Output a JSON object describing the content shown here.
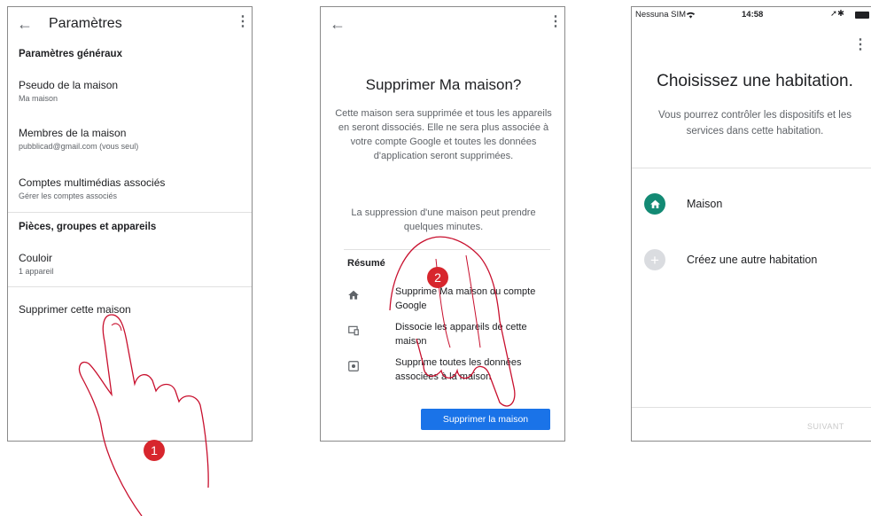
{
  "screen1": {
    "title": "Paramètres",
    "section_general": "Paramètres généraux",
    "items": [
      {
        "title": "Pseudo de la maison",
        "subtitle": "Ma maison"
      },
      {
        "title": "Membres de la maison",
        "subtitle": "pubblicad@gmail.com (vous seul)"
      },
      {
        "title": "Comptes multimédias associés",
        "subtitle": "Gérer les comptes associés"
      }
    ],
    "section_rooms": "Pièces, groupes et appareils",
    "room": {
      "title": "Couloir",
      "subtitle": "1 appareil"
    },
    "delete_label": "Supprimer cette maison"
  },
  "screen2": {
    "title": "Supprimer Ma maison?",
    "body": "Cette maison sera supprimée et tous les appareils en seront dissociés. Elle ne sera plus associée à votre compte Google et toutes les données d'application seront supprimées.",
    "note": "La suppression d'une maison peut prendre quelques minutes.",
    "summary_head": "Résumé",
    "summary": [
      {
        "icon": "home-icon",
        "text": "Supprime Ma maison du compte Google"
      },
      {
        "icon": "device-icon",
        "text": "Dissocie les appareils de cette maison"
      },
      {
        "icon": "data-icon",
        "text": "Supprime toutes les données associées à la maison"
      }
    ],
    "delete_button": "Supprimer la maison"
  },
  "screen3": {
    "status_carrier": "Nessuna SIM",
    "status_time": "14:58",
    "title": "Choisissez une habitation.",
    "body": "Vous pourrez contrôler les dispositifs et les services dans cette habitation.",
    "options": [
      {
        "label": "Maison",
        "icon": "home-icon"
      },
      {
        "label": "Créez une autre habitation",
        "icon": "plus-icon"
      }
    ],
    "next_button": "SUIVANT"
  },
  "steps": {
    "one": "1",
    "two": "2"
  },
  "colors": {
    "accent": "#1a73e8",
    "home_green": "#138a74",
    "step_badge": "#d7262d",
    "hand_outline": "#c8102e"
  }
}
